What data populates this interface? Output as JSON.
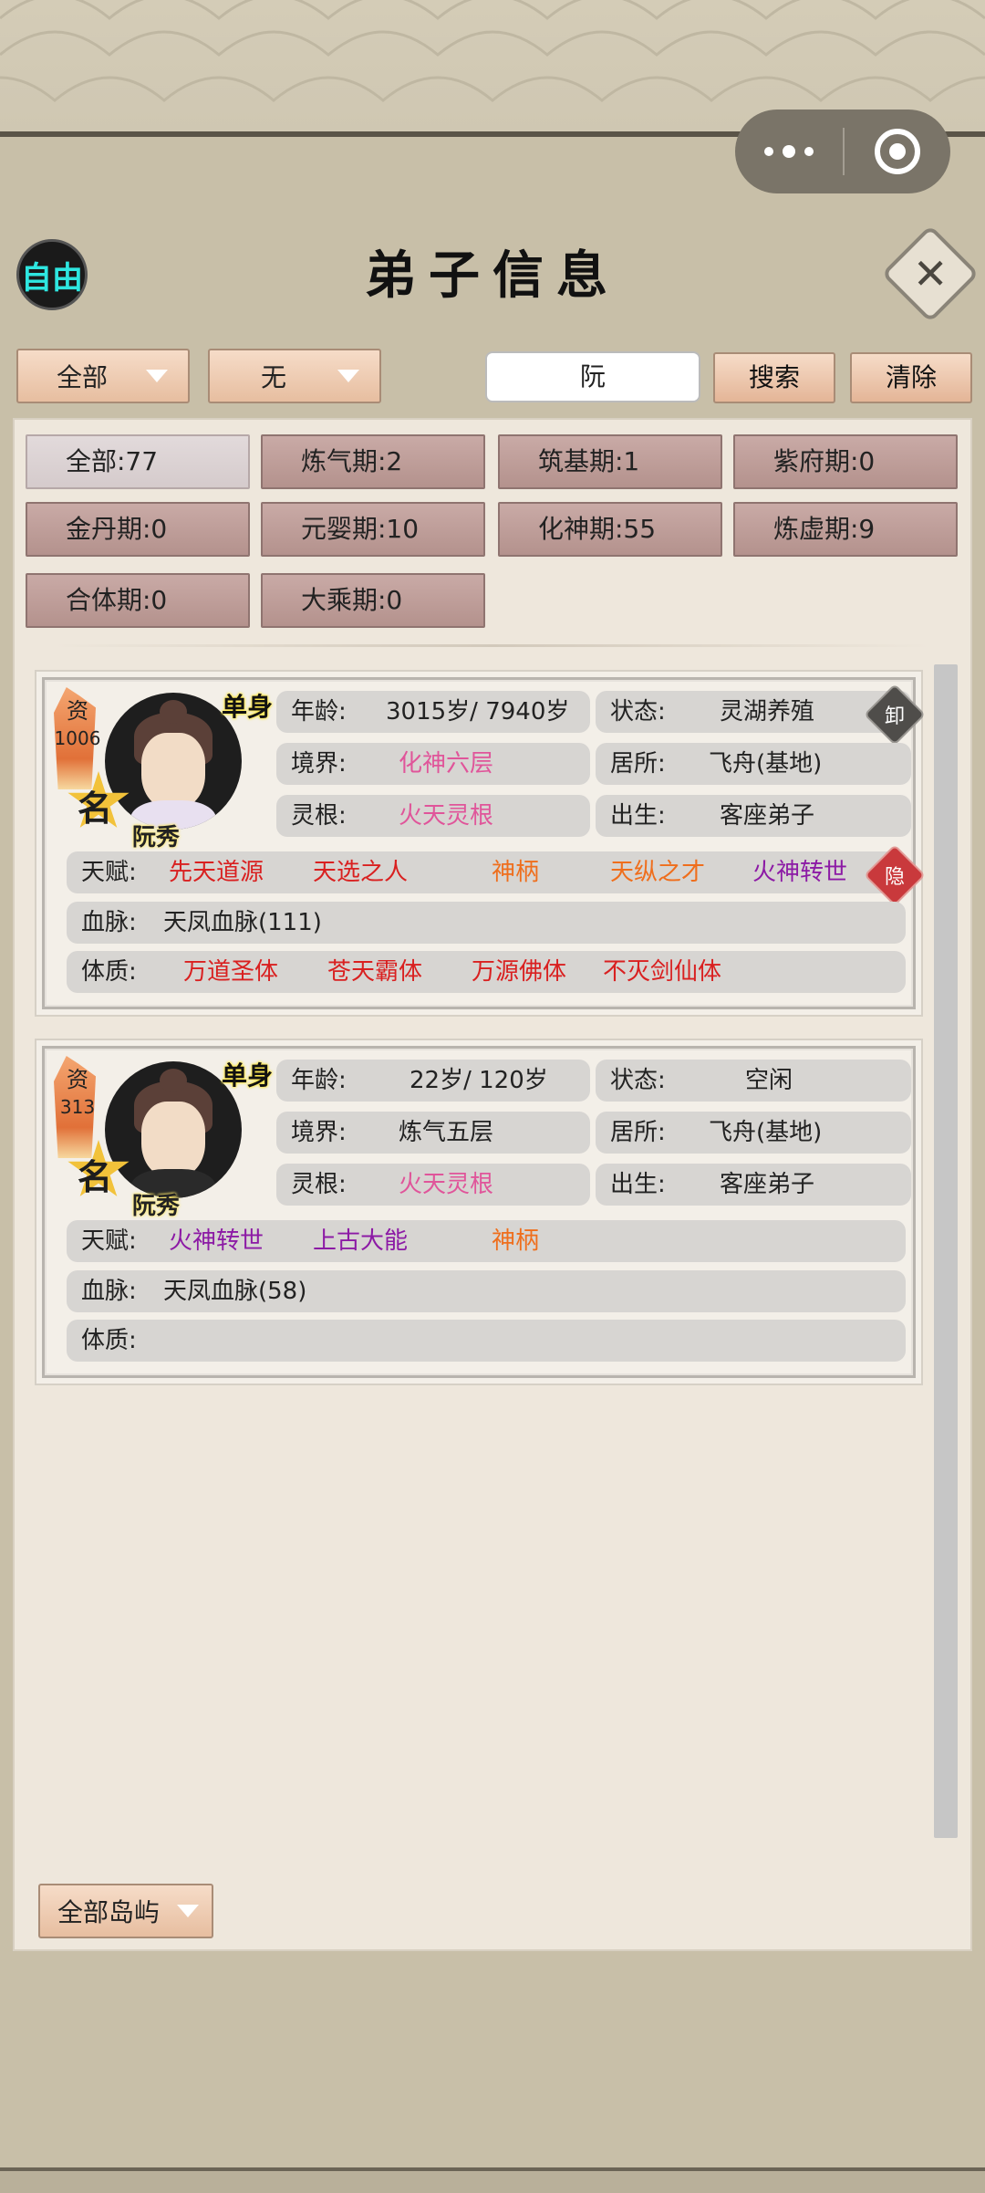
{
  "header": {
    "free_label": "自由",
    "title": "弟子信息"
  },
  "filters": {
    "dropdown1": "全部",
    "dropdown2": "无",
    "search_value": "阮",
    "search_button": "搜索",
    "clear_button": "清除"
  },
  "categories": [
    {
      "label": "全部:77"
    },
    {
      "label": "炼气期:2"
    },
    {
      "label": "筑基期:1"
    },
    {
      "label": "紫府期:0"
    },
    {
      "label": "金丹期:0"
    },
    {
      "label": "元婴期:10"
    },
    {
      "label": "化神期:55"
    },
    {
      "label": "炼虚期:9"
    },
    {
      "label": "合体期:0"
    },
    {
      "label": "大乘期:0"
    }
  ],
  "disciples": [
    {
      "zi_label": "资",
      "zi_value": "1006",
      "ming": "名",
      "marital": "单身",
      "name": "阮秀",
      "age_label": "年龄:",
      "age_value": "3015岁/ 7940岁",
      "status_label": "状态:",
      "status_value": "灵湖养殖",
      "status_tag": "卸",
      "realm_label": "境界:",
      "realm_value": "化神六层",
      "residence_label": "居所:",
      "residence_value": "飞舟(基地)",
      "root_label": "灵根:",
      "root_value": "火天灵根",
      "birth_label": "出生:",
      "birth_value": "客座弟子",
      "talent_label": "天赋:",
      "talents": [
        "先天道源",
        "天选之人",
        "神柄",
        "天纵之才",
        "火神转世"
      ],
      "talent_tag": "隐",
      "bloodline_label": "血脉:",
      "bloodline_value": "天凤血脉(111)",
      "physique_label": "体质:",
      "physiques": [
        "万道圣体",
        "苍天霸体",
        "万源佛体",
        "不灭剑仙体"
      ]
    },
    {
      "zi_label": "资",
      "zi_value": "313",
      "ming": "名",
      "marital": "单身",
      "name": "阮秀",
      "age_label": "年龄:",
      "age_value": "22岁/ 120岁",
      "status_label": "状态:",
      "status_value": "空闲",
      "realm_label": "境界:",
      "realm_value": "炼气五层",
      "residence_label": "居所:",
      "residence_value": "飞舟(基地)",
      "root_label": "灵根:",
      "root_value": "火天灵根",
      "birth_label": "出生:",
      "birth_value": "客座弟子",
      "talent_label": "天赋:",
      "talents": [
        "火神转世",
        "上古大能",
        "神柄"
      ],
      "bloodline_label": "血脉:",
      "bloodline_value": "天凤血脉(58)",
      "physique_label": "体质:",
      "physiques": []
    }
  ],
  "footer": {
    "island_filter": "全部岛屿"
  },
  "colors": {
    "pink": "#e0559a",
    "red": "#d92020",
    "orange": "#ef6e1c",
    "purple": "#8c1aa5"
  }
}
